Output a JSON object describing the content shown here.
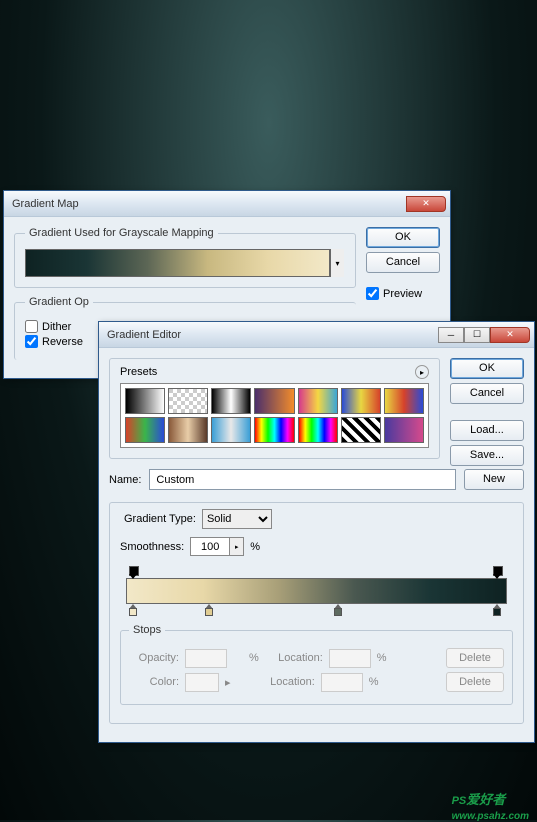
{
  "gradientMap": {
    "title": "Gradient Map",
    "fieldset1_legend": "Gradient Used for Grayscale Mapping",
    "fieldset2_legend": "Gradient Op",
    "ok": "OK",
    "cancel": "Cancel",
    "preview_label": "Preview",
    "preview_checked": true,
    "dither_label": "Dither",
    "dither_checked": false,
    "reverse_label": "Reverse",
    "reverse_checked": true
  },
  "gradientEditor": {
    "title": "Gradient Editor",
    "presets_label": "Presets",
    "ok": "OK",
    "cancel": "Cancel",
    "load": "Load...",
    "save": "Save...",
    "name_label": "Name:",
    "name_value": "Custom",
    "new_btn": "New",
    "gtype_label": "Gradient Type:",
    "gtype_value": "Solid",
    "smoothness_label": "Smoothness:",
    "smoothness_value": "100",
    "smoothness_unit": "%",
    "stops_legend": "Stops",
    "opacity_label": "Opacity:",
    "location_label": "Location:",
    "color_label": "Color:",
    "delete_label": "Delete",
    "pct": "%",
    "presets": [
      "linear-gradient(90deg,#000,#fff)",
      "repeating-conic-gradient(#fff 0 25%,#ccc 0 50%) 0/8px 8px",
      "linear-gradient(90deg,#000,#fff,#000)",
      "linear-gradient(90deg,#4b2f6b,#f28c2b)",
      "linear-gradient(90deg,#d63a8c,#f5d742,#3aa6d6)",
      "linear-gradient(90deg,#2a4bd6,#e8d742,#d6422a)",
      "linear-gradient(90deg,#e8d742,#d6422a,#2a4bd6)",
      "linear-gradient(90deg,#d6422a,#3ab54a,#2a4bd6)",
      "linear-gradient(90deg,#8a5a3a,#e8cda8,#5a3a2a)",
      "linear-gradient(90deg,#3a9ed6,#e8e8e8,#3a9ed6)",
      "linear-gradient(90deg,#ff0000,#ffff00,#00ff00,#00ffff,#0000ff,#ff00ff,#ff0000)",
      "linear-gradient(90deg,#ff0000,#ffff00,#00ff00,#00ffff,#0000ff,#ff00ff,#ff0000)",
      "repeating-linear-gradient(45deg,#000 0 4px,#fff 4px 8px)",
      "linear-gradient(90deg,#4a3a9e,#d64a8c)"
    ],
    "color_stops": [
      {
        "pos": 2,
        "color": "#f2e8c8"
      },
      {
        "pos": 22,
        "color": "#e0cd93"
      },
      {
        "pos": 56,
        "color": "#5d6a60"
      },
      {
        "pos": 98,
        "color": "#0e2222"
      }
    ],
    "opacity_stops": [
      {
        "pos": 2
      },
      {
        "pos": 98
      }
    ]
  },
  "watermark": {
    "big": "PS",
    "small": "爱好者",
    "url": "www.psahz.com"
  },
  "chart_data": null
}
